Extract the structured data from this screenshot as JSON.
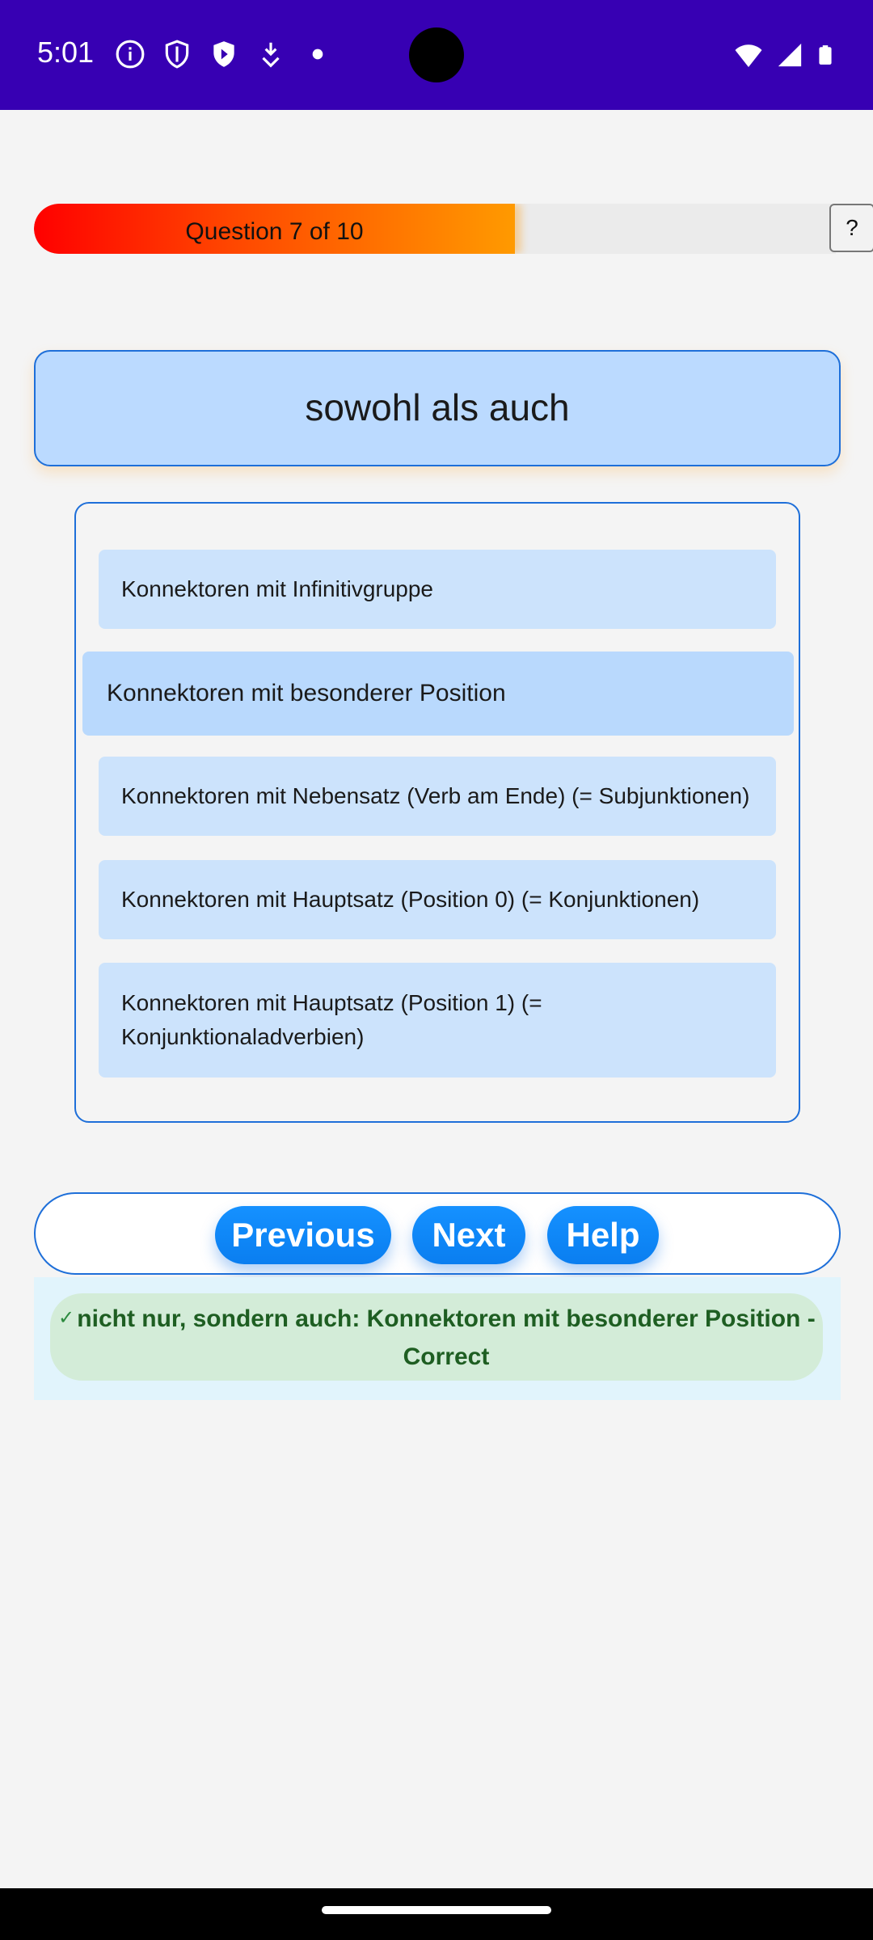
{
  "status_bar": {
    "time": "5:01",
    "left_icons": [
      "info-icon",
      "shield-outline-icon",
      "shield-play-icon",
      "download-icon",
      "dot-icon"
    ],
    "right_icons": [
      "wifi-icon",
      "signal-icon",
      "battery-icon"
    ],
    "background": "#3700b3"
  },
  "progress": {
    "label": "Question 7 of 10",
    "current": 7,
    "total": 10,
    "fraction": 0.6,
    "help_button": "?"
  },
  "question": {
    "text": "sowohl als auch"
  },
  "options": [
    {
      "label": "Konnektoren mit Infinitivgruppe",
      "selected": false
    },
    {
      "label": "Konnektoren mit besonderer Position",
      "selected": true
    },
    {
      "label": "Konnektoren mit Nebensatz (Verb am Ende) (= Subjunktionen)",
      "selected": false
    },
    {
      "label": "Konnektoren mit Hauptsatz (Position 0) (= Konjunktionen)",
      "selected": false
    },
    {
      "label": "Konnektoren mit Hauptsatz (Position 1) (= Konjunktionaladverbien)",
      "selected": false
    }
  ],
  "nav": {
    "previous": "Previous",
    "next": "Next",
    "help": "Help"
  },
  "feedback": {
    "icon": "check-icon",
    "text": "nicht nur, sondern auch: Konnektoren mit besonderer Position - Correct"
  },
  "colors": {
    "accent": "#1e6fd9",
    "button": "#0a7ef0",
    "option_bg": "#cce3fc",
    "feedback_bg": "#d3ecd8"
  }
}
